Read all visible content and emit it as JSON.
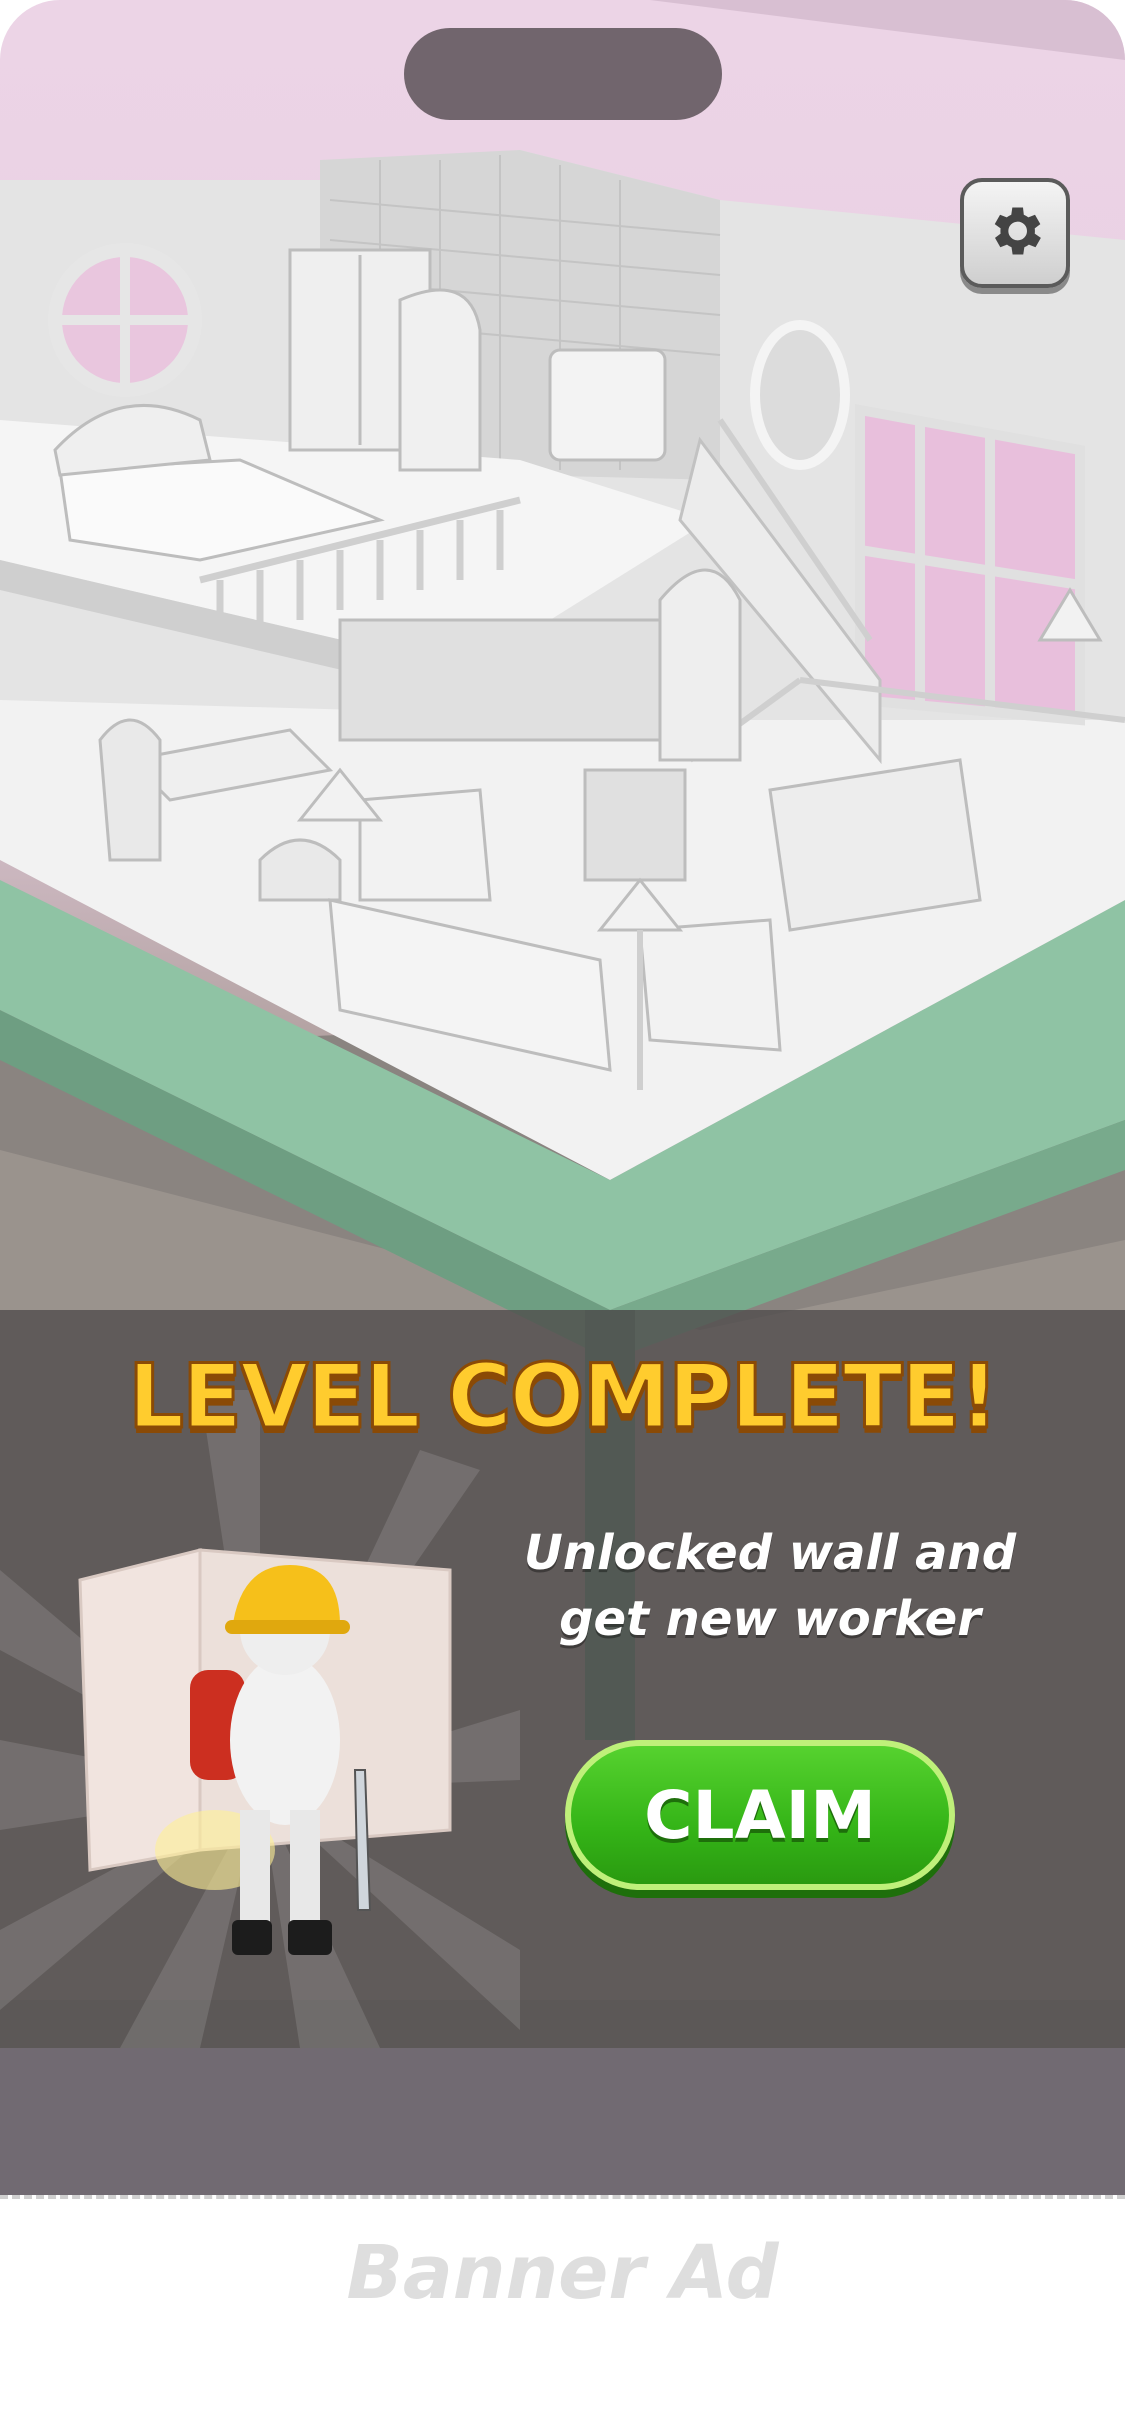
{
  "header": {
    "settings_icon": "gear-icon"
  },
  "popup": {
    "title": "LEVEL COMPLETE!",
    "message_line1": "Unlocked wall and",
    "message_line2": "get new worker",
    "claim_label": "CLAIM"
  },
  "banner": {
    "label": "Banner Ad"
  },
  "colors": {
    "title": "#ffcc2e",
    "claim_button": "#34b417",
    "floor_base": "#8fc3a4",
    "walls": "#ecd4e6"
  }
}
